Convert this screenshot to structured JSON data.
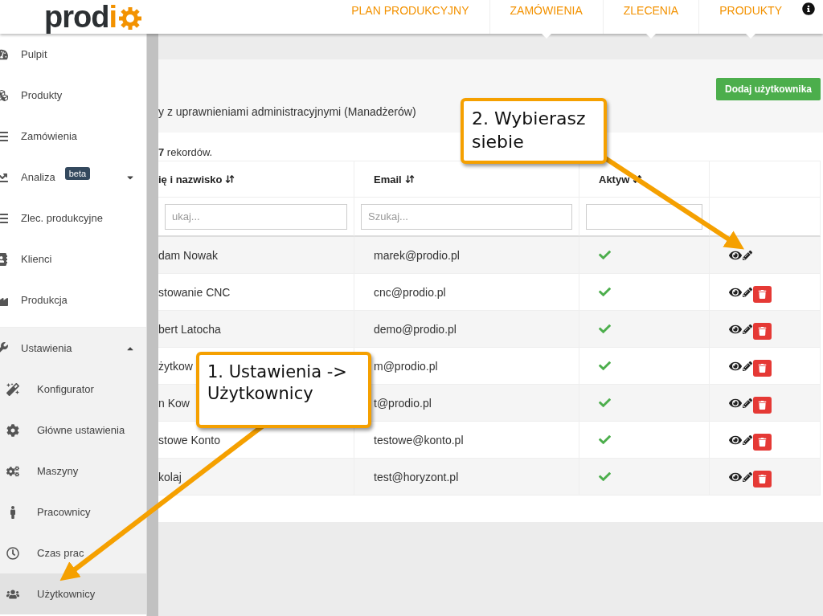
{
  "logo": {
    "text": "prod",
    "accent": "i"
  },
  "nav": [
    {
      "label": "PLAN PRODUKCYJNY",
      "pointer": false
    },
    {
      "label": "ZAMÓWIENIA",
      "pointer": true
    },
    {
      "label": "ZLECENIA",
      "pointer": true
    },
    {
      "label": "PRODUKTY",
      "pointer": true
    }
  ],
  "sidebar": {
    "items": [
      {
        "kind": "item",
        "label": "Pulpit",
        "selected": false
      },
      {
        "kind": "item",
        "label": "Produkty",
        "selected": false
      },
      {
        "kind": "item",
        "label": "Zamówienia",
        "selected": false
      },
      {
        "kind": "item",
        "label": "Analiza",
        "badge": "beta",
        "expanded": false,
        "selected": false
      },
      {
        "kind": "item",
        "label": "Zlec. produkcyjne",
        "selected": false
      },
      {
        "kind": "item",
        "label": "Klienci",
        "selected": false
      },
      {
        "kind": "item",
        "label": "Produkcja",
        "selected": false
      },
      {
        "kind": "group",
        "label": "Ustawienia",
        "expanded": true,
        "selected": false,
        "children": [
          {
            "label": "Konfigurator",
            "selected": false
          },
          {
            "label": "Główne ustawienia",
            "selected": false
          },
          {
            "label": "Maszyny",
            "selected": false
          },
          {
            "label": "Pracownicy",
            "selected": false
          },
          {
            "label": "Czas prac",
            "selected": false
          },
          {
            "label": "Użytkownicy",
            "selected": true
          }
        ]
      }
    ]
  },
  "toolbar": {
    "button": "Dodaj użytkownika"
  },
  "description": "y z uprawnieniami administracyjnymi (Manadżerów)",
  "record_count": "**7** rekordów.",
  "table": {
    "columns": [
      {
        "label": "ię i nazwisko",
        "sortable": true
      },
      {
        "label": "Email",
        "sortable": true
      },
      {
        "label": "Aktyw",
        "sortable": true
      },
      {
        "sortable": false
      }
    ],
    "filters": [
      {
        "kind": "text",
        "placeholder": "ukaj..."
      },
      {
        "kind": "text",
        "placeholder": "Szukaj..."
      },
      {
        "kind": "select"
      },
      {
        "kind": "none"
      }
    ],
    "rows": [
      {
        "name": "dam Nowak",
        "email": "marek@prodio.pl",
        "active": true,
        "can_delete": false
      },
      {
        "name": "stowanie CNC",
        "email": "cnc@prodio.pl",
        "active": true,
        "can_delete": true
      },
      {
        "name": "bert Latocha",
        "email": "demo@prodio.pl",
        "active": true,
        "can_delete": true
      },
      {
        "name": "żytkow",
        "email": "m@prodio.pl",
        "active": true,
        "can_delete": true
      },
      {
        "name": "n Kow",
        "email": "t@prodio.pl",
        "active": true,
        "can_delete": true
      },
      {
        "name": "stowe Konto",
        "email": "testowe@konto.pl",
        "active": true,
        "can_delete": true
      },
      {
        "name": "kolaj",
        "email": "test@horyzont.pl",
        "active": true,
        "can_delete": true
      }
    ]
  },
  "annotations": [
    {
      "text": "2. Wybierasz siebie"
    },
    {
      "text": "1. Ustawienia -> Użytkownicy"
    }
  ]
}
